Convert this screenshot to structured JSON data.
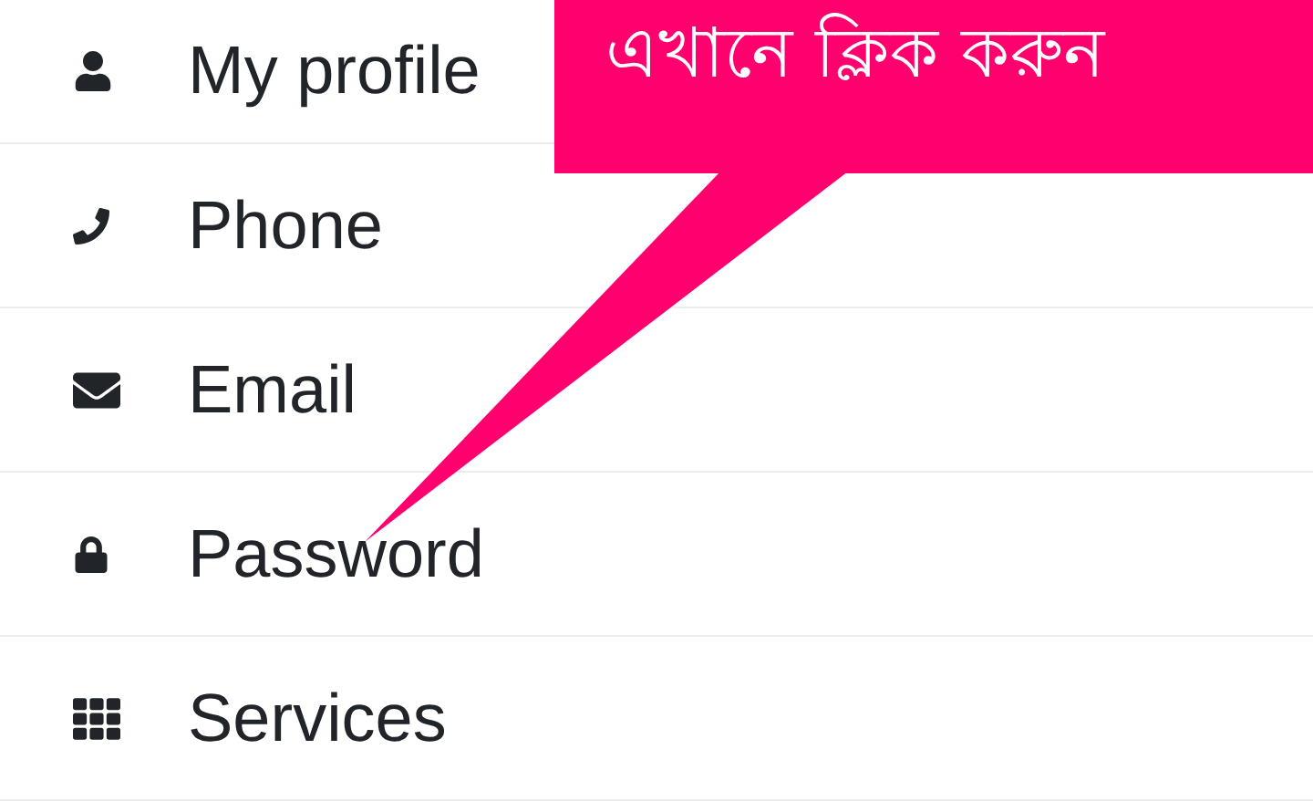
{
  "menu": {
    "items": [
      {
        "label": "My profile"
      },
      {
        "label": "Phone"
      },
      {
        "label": "Email"
      },
      {
        "label": "Password"
      },
      {
        "label": "Services"
      }
    ]
  },
  "callout": {
    "text": "এখানে ক্লিক করুন"
  }
}
